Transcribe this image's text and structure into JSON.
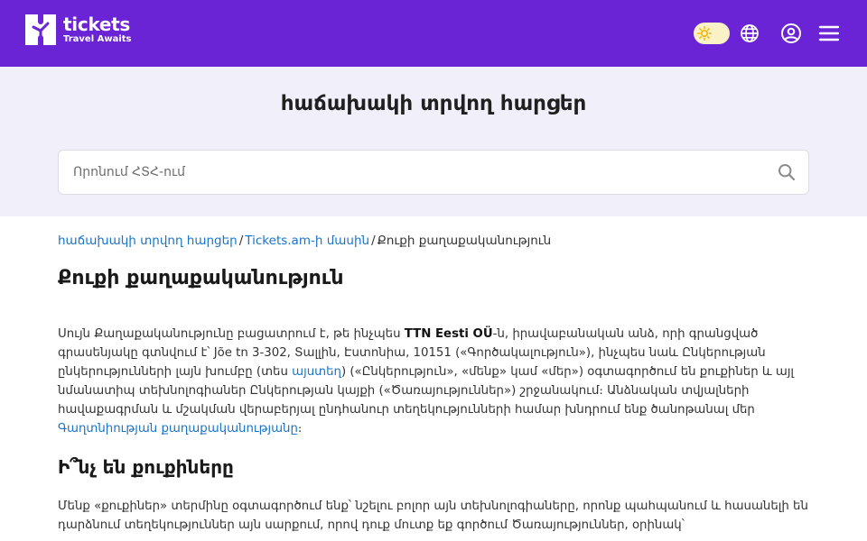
{
  "header": {
    "logo_name": "tickets",
    "logo_tagline": "Travel Awaits",
    "icons": [
      "sun-icon",
      "globe-icon",
      "user-icon",
      "hamburger-icon"
    ],
    "colors": {
      "brand": "#6a24d6",
      "toggle": "#fbf1c7",
      "sun": "#f4b400"
    }
  },
  "hero": {
    "title": "հաճախակի տրվող հարցեր",
    "search_placeholder": "Որոնում ՀՏՀ-ում"
  },
  "breadcrumb": {
    "items": [
      "հաճախակի տրվող հարցեր",
      "Tickets.am-ի մասին"
    ],
    "separator": "/",
    "current": "Քուքի քաղաքականություն"
  },
  "page": {
    "title": "Քուքի քաղաքականություն",
    "paragraph1": {
      "part1": "Սույն Քաղաքականությունը բացատրում է, թե ինչպես ",
      "company": "TTN Eesti OÜ",
      "part2": "-ն, իրավաբանական անձ, որի գրանցված գրասենյակը գտնվում է՝ Jõe tn 3-302, Տալլին, Էստոնիա, 10151 («Գործակալություն»), ինչպես նաև Ընկերության ընկերությունների լայն խումբը (տես ",
      "link1": "այստեղ",
      "part3": ") («Ընկերություն», «մենք» կամ «մեր») օգտագործում են քուքիներ և այլ նմանատիպ տեխնոլոգիաներ Ընկերության կայքի («Ծառայություններ») շրջանակում։ Անձնական տվյալների հավաքագրման և մշակման վերաբերյալ ընդհանուր տեղեկությունների համար խնդրում ենք ծանոթանալ մեր ",
      "link2": "Գաղտնիության քաղաքականությանը",
      "part4": "։"
    },
    "subheading": "Ի՞նչ են քուքիները",
    "paragraph2": "Մենք «քուքիներ» տերմինը օգտագործում ենք՝ նշելու բոլոր այն տեխնոլոգիաները, որոնք պահպանում և հասանելի են դարձնում տեղեկություններ այն սարքում, որով դուք մուտք եք գործում Ծառայություններ, օրինակ՝"
  }
}
